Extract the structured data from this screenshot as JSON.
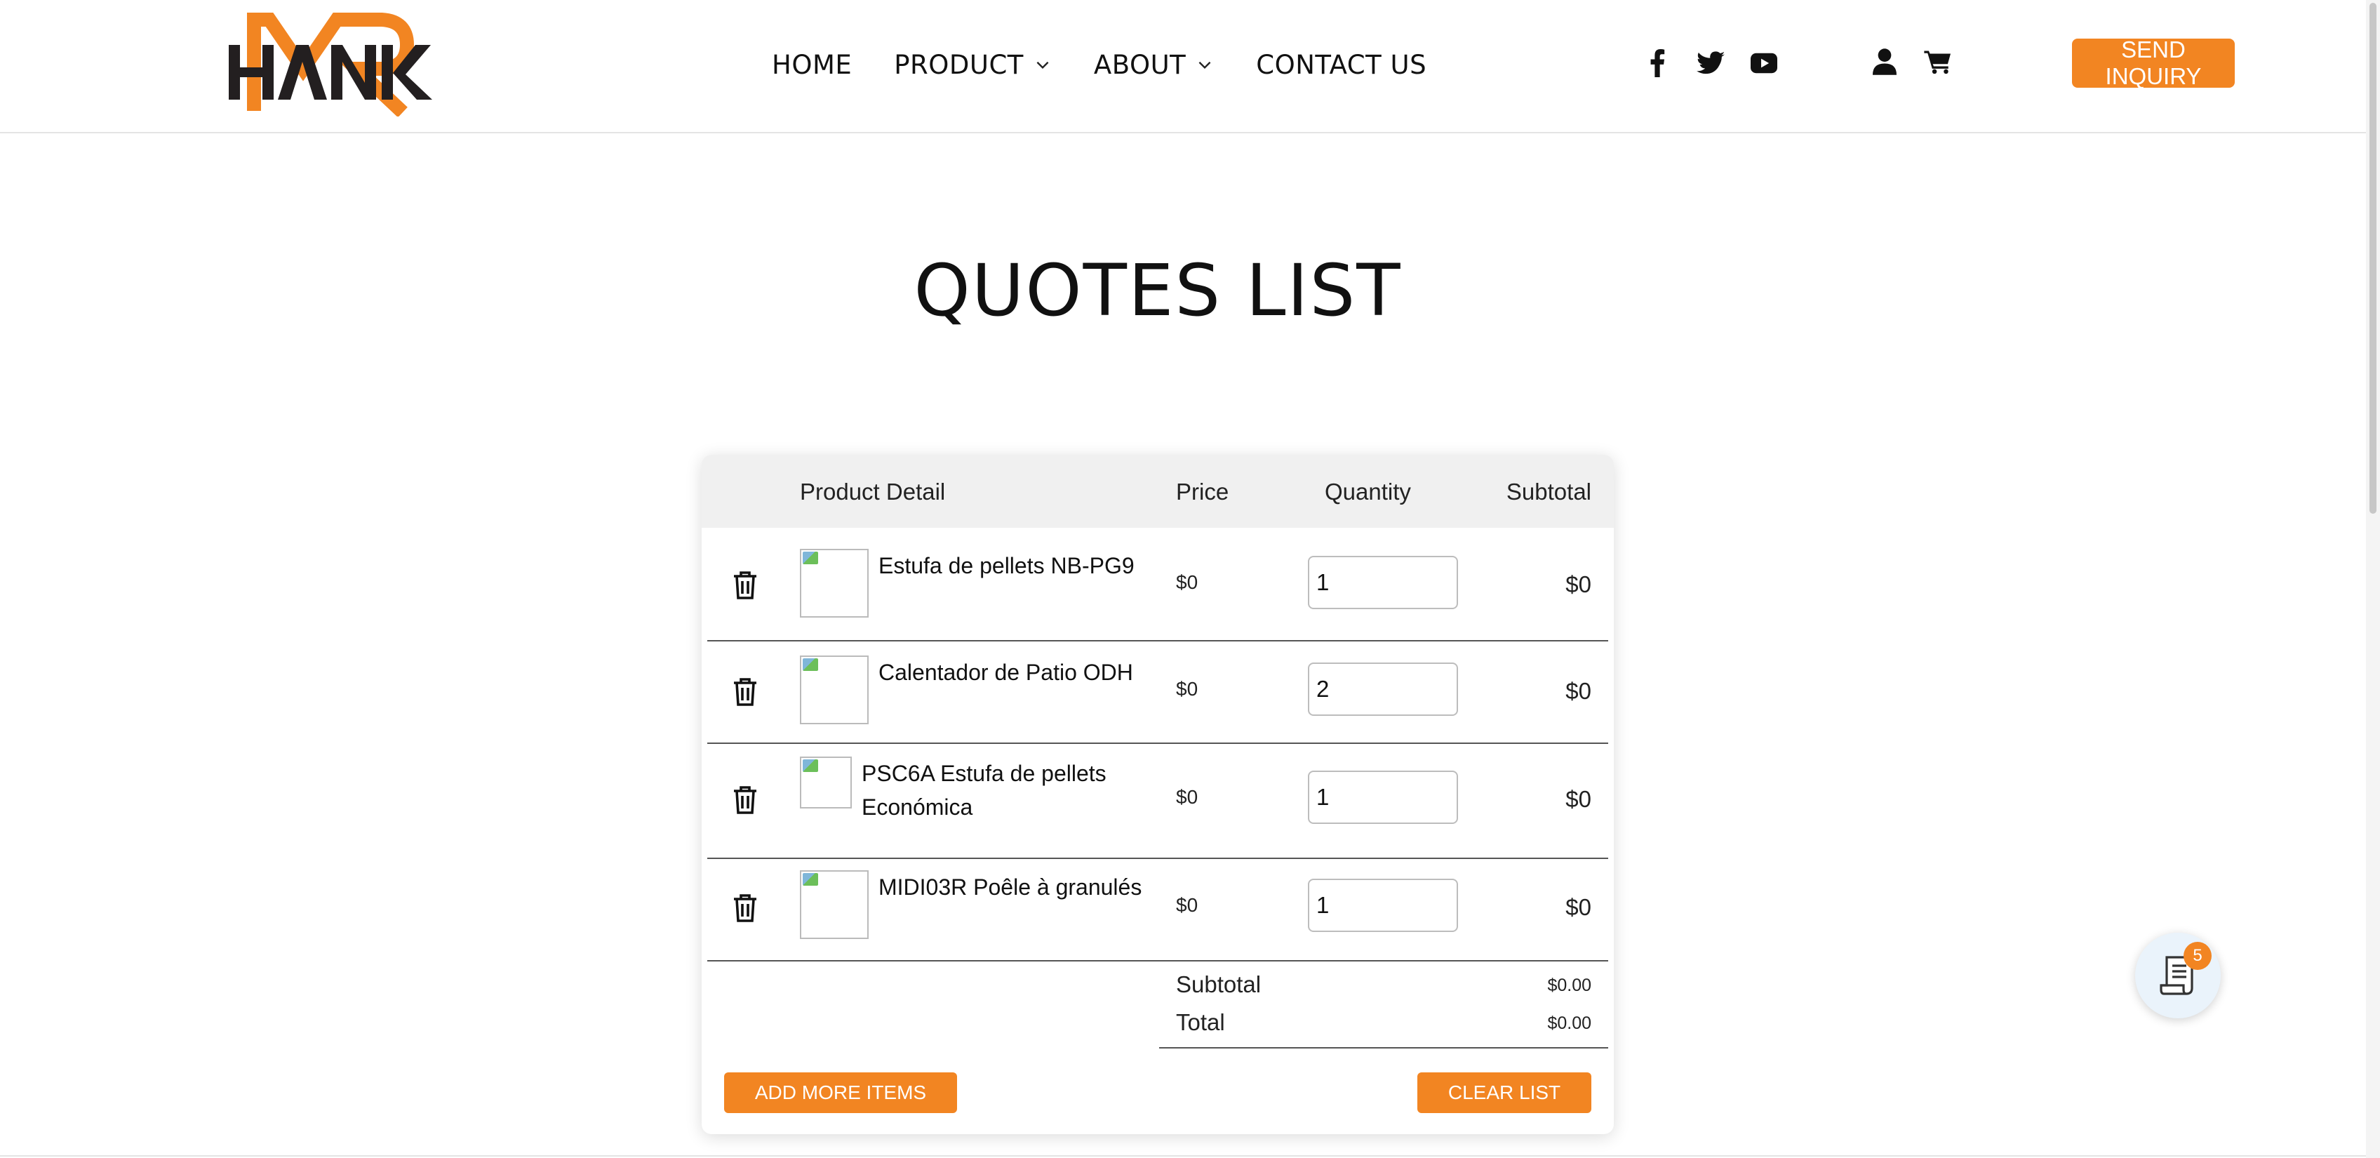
{
  "brand": {
    "logo_text": "HANK",
    "accent": "#f28522",
    "dark": "#231f20"
  },
  "nav": {
    "items": [
      {
        "label": "HOME",
        "has_dropdown": false
      },
      {
        "label": "PRODUCT",
        "has_dropdown": true
      },
      {
        "label": "ABOUT",
        "has_dropdown": true
      },
      {
        "label": "CONTACT US",
        "has_dropdown": false
      }
    ]
  },
  "social": [
    "facebook-icon",
    "twitter-icon",
    "youtube-icon"
  ],
  "account": [
    "user-icon",
    "cart-icon"
  ],
  "header": {
    "send_inquiry_label": "SEND INQUIRY"
  },
  "page": {
    "title": "QUOTES LIST"
  },
  "table": {
    "headers": {
      "product": "Product Detail",
      "price": "Price",
      "quantity": "Quantity",
      "subtotal": "Subtotal"
    },
    "rows": [
      {
        "name": "Estufa de pellets NB-PG9",
        "price": "$0",
        "quantity": "1",
        "subtotal": "$0"
      },
      {
        "name": "Calentador de Patio ODH",
        "price": "$0",
        "quantity": "2",
        "subtotal": "$0"
      },
      {
        "name": "PSC6A Estufa de pellets Económica",
        "price": "$0",
        "quantity": "1",
        "subtotal": "$0"
      },
      {
        "name": "MIDI03R Poêle à granulés",
        "price": "$0",
        "quantity": "1",
        "subtotal": "$0"
      }
    ]
  },
  "summary": {
    "subtotal_label": "Subtotal",
    "subtotal_value": "$0.00",
    "total_label": "Total",
    "total_value": "$0.00"
  },
  "actions": {
    "add_more_label": "ADD MORE ITEMS",
    "clear_list_label": "CLEAR LIST"
  },
  "widget": {
    "badge_count": "5"
  }
}
